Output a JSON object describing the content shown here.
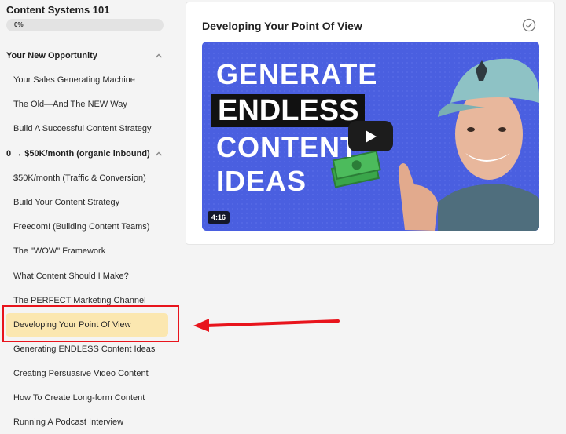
{
  "course": {
    "title": "Content Systems 101",
    "progress_label": "0%",
    "progress_fraction": 0.0
  },
  "sections": [
    {
      "title": "Your New Opportunity",
      "lessons": [
        "Your Sales Generating Machine",
        "The Old—And The NEW Way",
        "Build A Successful Content Strategy"
      ]
    },
    {
      "title": "0 → $50K/month (organic inbound)",
      "lessons": [
        "$50K/month (Traffic & Conversion)",
        "Build Your Content Strategy",
        "Freedom! (Building Content Teams)",
        "The \"WOW\" Framework",
        "What Content Should I Make?",
        "The PERFECT Marketing Channel",
        "Developing Your Point Of View",
        "Generating ENDLESS Content Ideas",
        "Creating Persuasive Video Content",
        "How To Create Long-form Content",
        "Running A Podcast Interview"
      ]
    }
  ],
  "active_lesson": "Developing Your Point Of View",
  "main": {
    "lesson_title": "Developing Your Point Of View",
    "video": {
      "thumbnail_lines": [
        "GENERATE",
        "ENDLESS",
        "CONTENT",
        "IDEAS"
      ],
      "duration": "4:16"
    }
  },
  "colors": {
    "active_lesson_bg": "#fbe7b0",
    "annotation_red": "#e8141c",
    "thumbnail_blue": "#4a5fe0"
  },
  "icons": {
    "section_toggle": "chevron-up-icon",
    "complete": "check-circle-icon",
    "play": "play-icon"
  }
}
